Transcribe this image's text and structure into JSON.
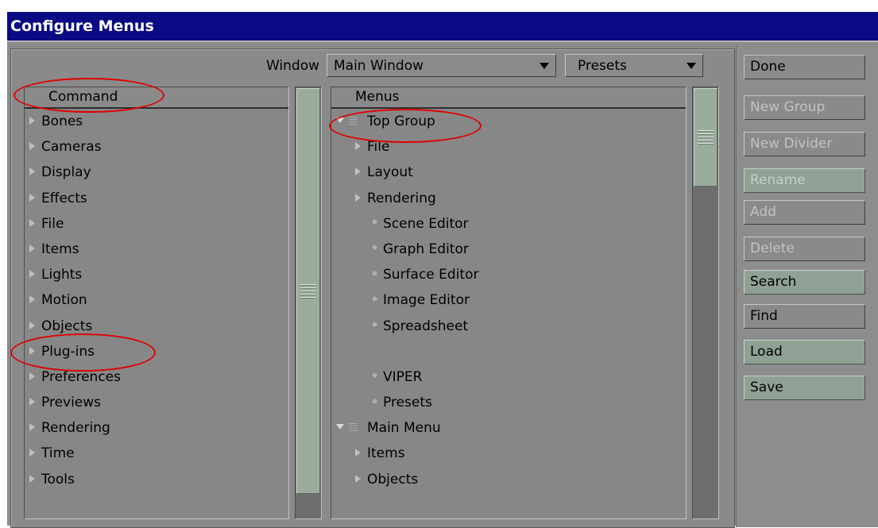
{
  "window": {
    "title": "Configure Menus"
  },
  "toolbar": {
    "window_label": "Window",
    "window_select": "Main Window",
    "presets_select": "Presets"
  },
  "command_list": {
    "header": "Command",
    "items": [
      "Bones",
      "Cameras",
      "Display",
      "Effects",
      "File",
      "Items",
      "Lights",
      "Motion",
      "Objects",
      "Plug-ins",
      "Preferences",
      "Previews",
      "Rendering",
      "Time",
      "Tools"
    ]
  },
  "menus_list": {
    "header": "Menus",
    "items": [
      {
        "label": "Top Group",
        "type": "group"
      },
      {
        "label": "File",
        "type": "submenu"
      },
      {
        "label": "Layout",
        "type": "submenu"
      },
      {
        "label": "Rendering",
        "type": "submenu"
      },
      {
        "label": "Scene Editor",
        "type": "command"
      },
      {
        "label": "Graph Editor",
        "type": "command"
      },
      {
        "label": "Surface Editor",
        "type": "command"
      },
      {
        "label": "Image Editor",
        "type": "command"
      },
      {
        "label": "Spreadsheet",
        "type": "command"
      },
      {
        "label": "",
        "type": "divider"
      },
      {
        "label": "VIPER",
        "type": "command"
      },
      {
        "label": "Presets",
        "type": "command"
      },
      {
        "label": "Main Menu",
        "type": "group"
      },
      {
        "label": "Items",
        "type": "submenu"
      },
      {
        "label": "Objects",
        "type": "submenu"
      }
    ]
  },
  "buttons": {
    "done": "Done",
    "new_group": "New Group",
    "new_divider": "New Divider",
    "rename": "Rename",
    "add": "Add",
    "delete": "Delete",
    "search": "Search",
    "find": "Find",
    "load": "Load",
    "save": "Save"
  },
  "colors": {
    "title_bar": "#0a0a84",
    "panel": "#8a8a8a",
    "accent_green": "#8fa194",
    "annotation": "#e00000"
  }
}
